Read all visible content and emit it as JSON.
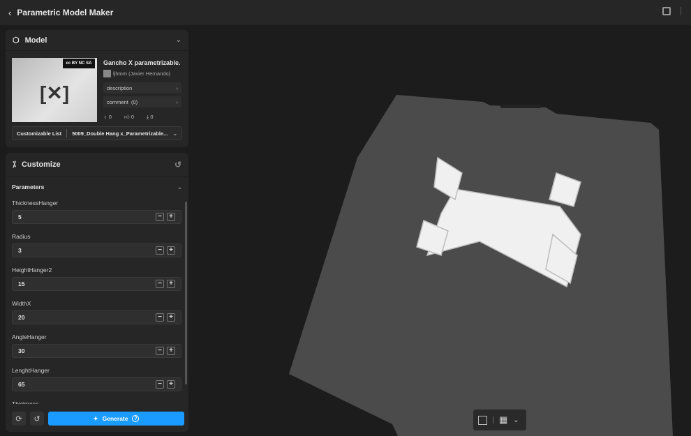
{
  "header": {
    "title": "Parametric Model Maker"
  },
  "model": {
    "section_title": "Model",
    "name": "Gancho X parametrizable.",
    "author": "ljhtom (Javier Hernando)",
    "license_badge": "cc BY NC SA",
    "description_label": "description",
    "comment_label": "comment",
    "comment_count": "(0)",
    "stats": {
      "boosts": "0",
      "likes": "0",
      "downloads": "0"
    },
    "customizable_list_label": "Customizable List",
    "customizable_list_value": "5009_Double Hang x_Parametrizable..."
  },
  "customize": {
    "section_title": "Customize",
    "parameters_title": "Parameters",
    "params": [
      {
        "label": "ThicknessHanger",
        "value": "5"
      },
      {
        "label": "Radius",
        "value": "3"
      },
      {
        "label": "HeightHanger2",
        "value": "15"
      },
      {
        "label": "WidthX",
        "value": "20"
      },
      {
        "label": "AngleHanger",
        "value": "30"
      },
      {
        "label": "LenghtHanger",
        "value": "65"
      },
      {
        "label": "Thickness",
        "value": ""
      }
    ],
    "generate_label": "Generate"
  },
  "colors": {
    "accent": "#1a9bff"
  }
}
